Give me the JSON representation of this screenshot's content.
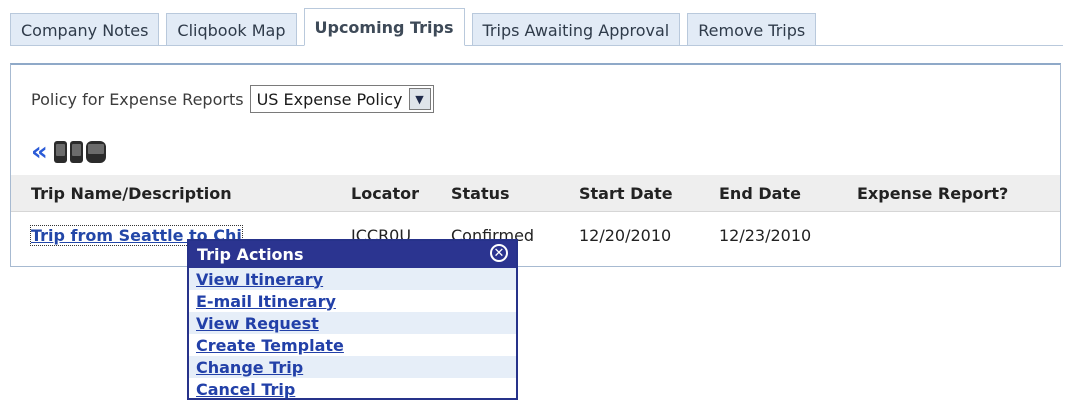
{
  "tabs": [
    {
      "label": "Company Notes"
    },
    {
      "label": "Cliqbook Map"
    },
    {
      "label": "Upcoming Trips",
      "active": true
    },
    {
      "label": "Trips Awaiting Approval"
    },
    {
      "label": "Remove Trips"
    }
  ],
  "policy": {
    "label": "Policy for Expense Reports",
    "selected": "US Expense Policy"
  },
  "icons": [
    "double-left-chevron-icon",
    "phone-icon",
    "phone-icon",
    "blackberry-icon"
  ],
  "table": {
    "headers": [
      "Trip Name/Description",
      "Locator",
      "Status",
      "Start Date",
      "End Date",
      "Expense Report?"
    ],
    "rows": [
      {
        "trip_name": "Trip from Seattle to Chi",
        "locator": "JCCR0U",
        "status": "Confirmed",
        "start_date": "12/20/2010",
        "end_date": "12/23/2010",
        "expense_report": ""
      }
    ]
  },
  "popup": {
    "title": "Trip Actions",
    "actions": [
      {
        "label": "View Itinerary"
      },
      {
        "label": "E-mail Itinerary"
      },
      {
        "label": "View Request"
      },
      {
        "label": "Create Template"
      },
      {
        "label": "Change Trip"
      },
      {
        "label": "Cancel Trip"
      }
    ]
  },
  "colors": {
    "link": "#2347a8",
    "popup_header": "#2b3490",
    "tab_bg": "#e2ebf6",
    "table_header_bg": "#eeeeee"
  }
}
